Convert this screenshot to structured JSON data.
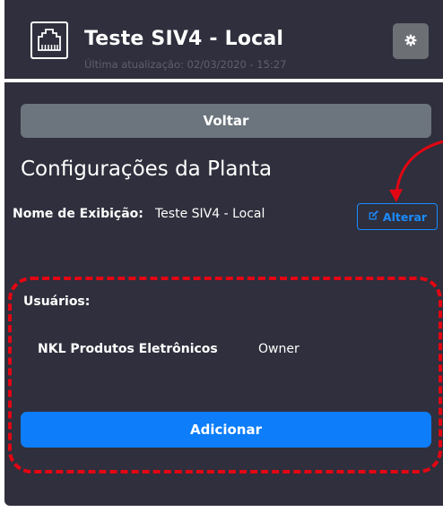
{
  "header": {
    "title": "Teste SIV4 - Local",
    "subtitle": "Última atualização: 02/03/2020 - 15:27",
    "logo_icon": "network-port-icon",
    "settings_icon": "gear-icon"
  },
  "actions": {
    "back_label": "Voltar",
    "add_label": "Adicionar"
  },
  "section": {
    "title": "Configurações da Planta"
  },
  "display_name": {
    "label": "Nome de Exibição:",
    "value": "Teste SIV4 - Local",
    "edit_label": "Alterar",
    "edit_icon": "edit-icon"
  },
  "users": {
    "label": "Usuários:",
    "list": [
      {
        "name": "NKL Produtos Eletrônicos",
        "role": "Owner"
      }
    ]
  },
  "colors": {
    "panel_bg": "#2f2f3d",
    "secondary_button": "#6c757d",
    "primary_button": "#0d7dfa",
    "annotation_red": "#e30613"
  }
}
